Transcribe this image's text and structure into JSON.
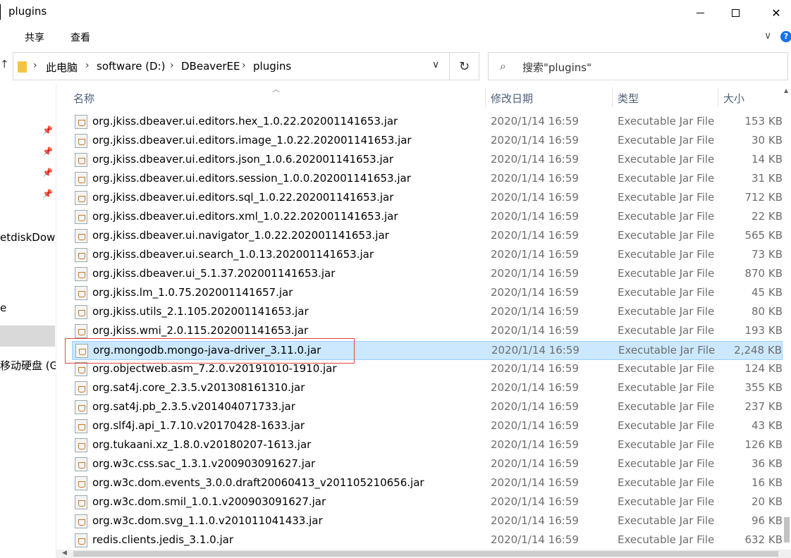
{
  "window": {
    "title": "plugins",
    "minimize_glyph": "—",
    "close_glyph": "✕"
  },
  "ribbon": {
    "tabs": [
      "共享",
      "查看"
    ],
    "expand_glyph": "∨",
    "help_glyph": "?"
  },
  "address": {
    "breadcrumbs": [
      "此电脑",
      "software (D:)",
      "DBeaverEE",
      "plugins"
    ],
    "separator": "›",
    "dropdown_glyph": "∨",
    "refresh_glyph": "↻"
  },
  "search": {
    "placeholder": "搜索\"plugins\"",
    "icon": "search-icon"
  },
  "navpane": {
    "items": [
      "etdiskDow",
      "e",
      "移动硬盘 (G"
    ],
    "pin_glyph": "📌"
  },
  "columns": {
    "name": "名称",
    "date": "修改日期",
    "type": "类型",
    "size": "大小"
  },
  "files": [
    {
      "name": "org.jkiss.dbeaver.ui.editors.hex_1.0.22.202001141653.jar",
      "date": "2020/1/14 16:59",
      "type": "Executable Jar File",
      "size": "153 KB"
    },
    {
      "name": "org.jkiss.dbeaver.ui.editors.image_1.0.22.202001141653.jar",
      "date": "2020/1/14 16:59",
      "type": "Executable Jar File",
      "size": "30 KB"
    },
    {
      "name": "org.jkiss.dbeaver.ui.editors.json_1.0.6.202001141653.jar",
      "date": "2020/1/14 16:59",
      "type": "Executable Jar File",
      "size": "14 KB"
    },
    {
      "name": "org.jkiss.dbeaver.ui.editors.session_1.0.0.202001141653.jar",
      "date": "2020/1/14 16:59",
      "type": "Executable Jar File",
      "size": "31 KB"
    },
    {
      "name": "org.jkiss.dbeaver.ui.editors.sql_1.0.22.202001141653.jar",
      "date": "2020/1/14 16:59",
      "type": "Executable Jar File",
      "size": "712 KB"
    },
    {
      "name": "org.jkiss.dbeaver.ui.editors.xml_1.0.22.202001141653.jar",
      "date": "2020/1/14 16:59",
      "type": "Executable Jar File",
      "size": "22 KB"
    },
    {
      "name": "org.jkiss.dbeaver.ui.navigator_1.0.22.202001141653.jar",
      "date": "2020/1/14 16:59",
      "type": "Executable Jar File",
      "size": "565 KB"
    },
    {
      "name": "org.jkiss.dbeaver.ui.search_1.0.13.202001141653.jar",
      "date": "2020/1/14 16:59",
      "type": "Executable Jar File",
      "size": "73 KB"
    },
    {
      "name": "org.jkiss.dbeaver.ui_5.1.37.202001141653.jar",
      "date": "2020/1/14 16:59",
      "type": "Executable Jar File",
      "size": "870 KB"
    },
    {
      "name": "org.jkiss.lm_1.0.75.202001141657.jar",
      "date": "2020/1/14 16:59",
      "type": "Executable Jar File",
      "size": "45 KB"
    },
    {
      "name": "org.jkiss.utils_2.1.105.202001141653.jar",
      "date": "2020/1/14 16:59",
      "type": "Executable Jar File",
      "size": "80 KB"
    },
    {
      "name": "org.jkiss.wmi_2.0.115.202001141653.jar",
      "date": "2020/1/14 16:59",
      "type": "Executable Jar File",
      "size": "193 KB"
    },
    {
      "name": "org.mongodb.mongo-java-driver_3.11.0.jar",
      "date": "2020/1/14 16:59",
      "type": "Executable Jar File",
      "size": "2,248 KB",
      "selected": true
    },
    {
      "name": "org.objectweb.asm_7.2.0.v20191010-1910.jar",
      "date": "2020/1/14 16:59",
      "type": "Executable Jar File",
      "size": "124 KB"
    },
    {
      "name": "org.sat4j.core_2.3.5.v201308161310.jar",
      "date": "2020/1/14 16:59",
      "type": "Executable Jar File",
      "size": "355 KB"
    },
    {
      "name": "org.sat4j.pb_2.3.5.v201404071733.jar",
      "date": "2020/1/14 16:59",
      "type": "Executable Jar File",
      "size": "237 KB"
    },
    {
      "name": "org.slf4j.api_1.7.10.v20170428-1633.jar",
      "date": "2020/1/14 16:59",
      "type": "Executable Jar File",
      "size": "43 KB"
    },
    {
      "name": "org.tukaani.xz_1.8.0.v20180207-1613.jar",
      "date": "2020/1/14 16:59",
      "type": "Executable Jar File",
      "size": "126 KB"
    },
    {
      "name": "org.w3c.css.sac_1.3.1.v200903091627.jar",
      "date": "2020/1/14 16:59",
      "type": "Executable Jar File",
      "size": "36 KB"
    },
    {
      "name": "org.w3c.dom.events_3.0.0.draft20060413_v201105210656.jar",
      "date": "2020/1/14 16:59",
      "type": "Executable Jar File",
      "size": "16 KB"
    },
    {
      "name": "org.w3c.dom.smil_1.0.1.v200903091627.jar",
      "date": "2020/1/14 16:59",
      "type": "Executable Jar File",
      "size": "20 KB"
    },
    {
      "name": "org.w3c.dom.svg_1.1.0.v201011041433.jar",
      "date": "2020/1/14 16:59",
      "type": "Executable Jar File",
      "size": "96 KB"
    },
    {
      "name": "redis.clients.jedis_3.1.0.jar",
      "date": "2020/1/14 16:59",
      "type": "Executable Jar File",
      "size": "632 KB"
    }
  ],
  "colors": {
    "selection": "#cce8ff",
    "highlight_border": "#e0453a",
    "header_text": "#4c607a"
  }
}
